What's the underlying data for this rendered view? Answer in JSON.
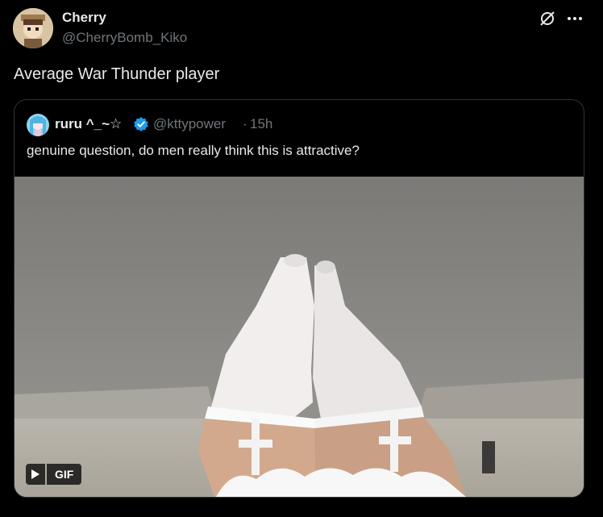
{
  "tweet": {
    "author_name": "Cherry",
    "author_handle": "@CherryBomb_Kiko",
    "text": "Average War Thunder player",
    "icons": {
      "grok": "grok-icon",
      "more": "more-icon"
    }
  },
  "quote": {
    "author_name": "ruru ^_~☆",
    "author_handle": "@kttypower",
    "separator": "·",
    "time": "15h",
    "text": "genuine question, do men really think this is attractive?",
    "verified_color": "#1d9bf0",
    "media": {
      "type": "GIF",
      "badge_label": "GIF",
      "play_icon": "play-icon"
    }
  }
}
